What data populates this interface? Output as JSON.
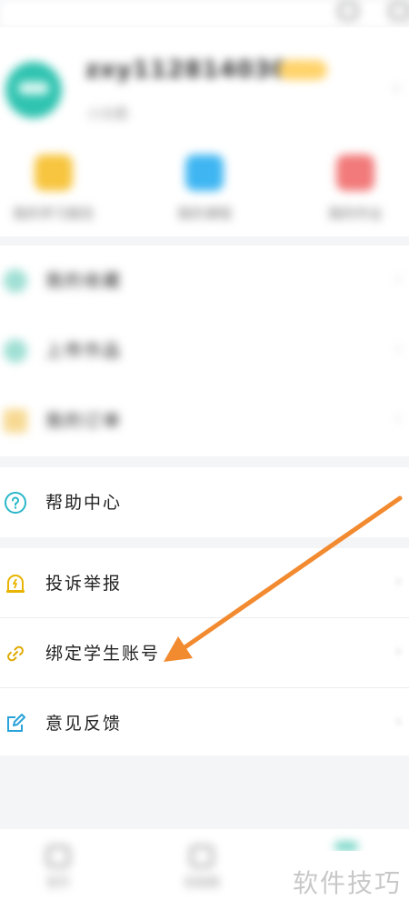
{
  "header": {
    "username": "zxy1128140303",
    "subtitle": "小白鹿"
  },
  "quick_actions": [
    {
      "label": "我的学习报告",
      "color": "#f7c53f"
    },
    {
      "label": "我的课程",
      "color": "#3fb6f2"
    },
    {
      "label": "我的作业",
      "color": "#f27a7a"
    }
  ],
  "menu_blurred": [
    {
      "label": "我的收藏",
      "icon": "bookmark-icon",
      "color": "#9fdfd4"
    },
    {
      "label": "上传作品",
      "icon": "upload-icon",
      "color": "#9fdfd4"
    },
    {
      "label": "我的订单",
      "icon": "order-icon",
      "color": "#f7d992"
    }
  ],
  "menu": {
    "help": {
      "label": "帮助中心",
      "icon": "question-circle-icon",
      "color": "#29b7c9"
    },
    "complaint": {
      "label": "投诉举报",
      "icon": "alert-bell-icon",
      "color": "#e8b400"
    },
    "bind": {
      "label": "绑定学生账号",
      "icon": "link-icon",
      "color": "#e0a800"
    },
    "feedback": {
      "label": "意见反馈",
      "icon": "edit-icon",
      "color": "#29a3d9"
    }
  },
  "bottom_nav": [
    {
      "label": "首页",
      "icon": "home-icon"
    },
    {
      "label": "班级圈",
      "icon": "folder-icon"
    }
  ],
  "watermark": "软件技巧",
  "accent_color": "#f28a30"
}
